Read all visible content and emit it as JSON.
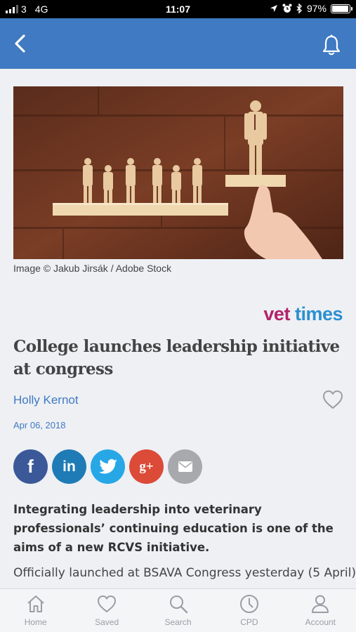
{
  "status_bar": {
    "carrier": "3",
    "network": "4G",
    "time": "11:07",
    "battery": "97%",
    "battery_level": 0.97
  },
  "header": {
    "back_icon": "chevron-left-icon",
    "notifications_icon": "bell-icon",
    "color": "#3f7ac2"
  },
  "article": {
    "image_caption": "Image © Jakub Jirsák / Adobe Stock",
    "brand_part1": "vet",
    "brand_part2": "times",
    "title": "College launches leadership initiative at congress",
    "author": "Holly Kernot",
    "date": "Apr 06, 2018",
    "lead": "Integrating leadership into veterinary professionals’ continuing education is one of the aims of a new RCVS initiative.",
    "body_start": "Officially launched at BSAVA Congress yesterday (5 April)"
  },
  "share": {
    "facebook": "f",
    "linkedin": "in",
    "twitter_icon": "twitter-bird-icon",
    "googleplus": "g+",
    "email_icon": "envelope-icon"
  },
  "tabs": [
    {
      "label": "Home",
      "icon": "home-icon"
    },
    {
      "label": "Saved",
      "icon": "heart-icon"
    },
    {
      "label": "Search",
      "icon": "search-icon"
    },
    {
      "label": "CPD",
      "icon": "clock-icon"
    },
    {
      "label": "Account",
      "icon": "user-icon"
    }
  ]
}
